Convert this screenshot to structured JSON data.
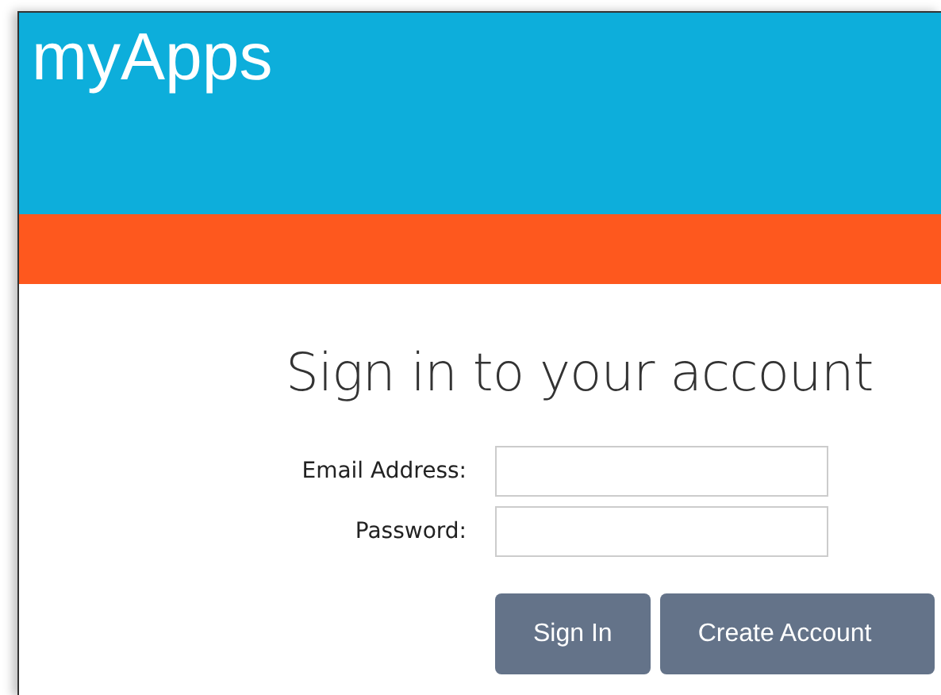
{
  "header": {
    "title": "myApps"
  },
  "login": {
    "heading": "Sign in to your account",
    "fields": [
      {
        "label": "Email Address:"
      },
      {
        "label": "Password:"
      }
    ],
    "buttons": [
      "Sign In",
      "Create Account"
    ]
  }
}
